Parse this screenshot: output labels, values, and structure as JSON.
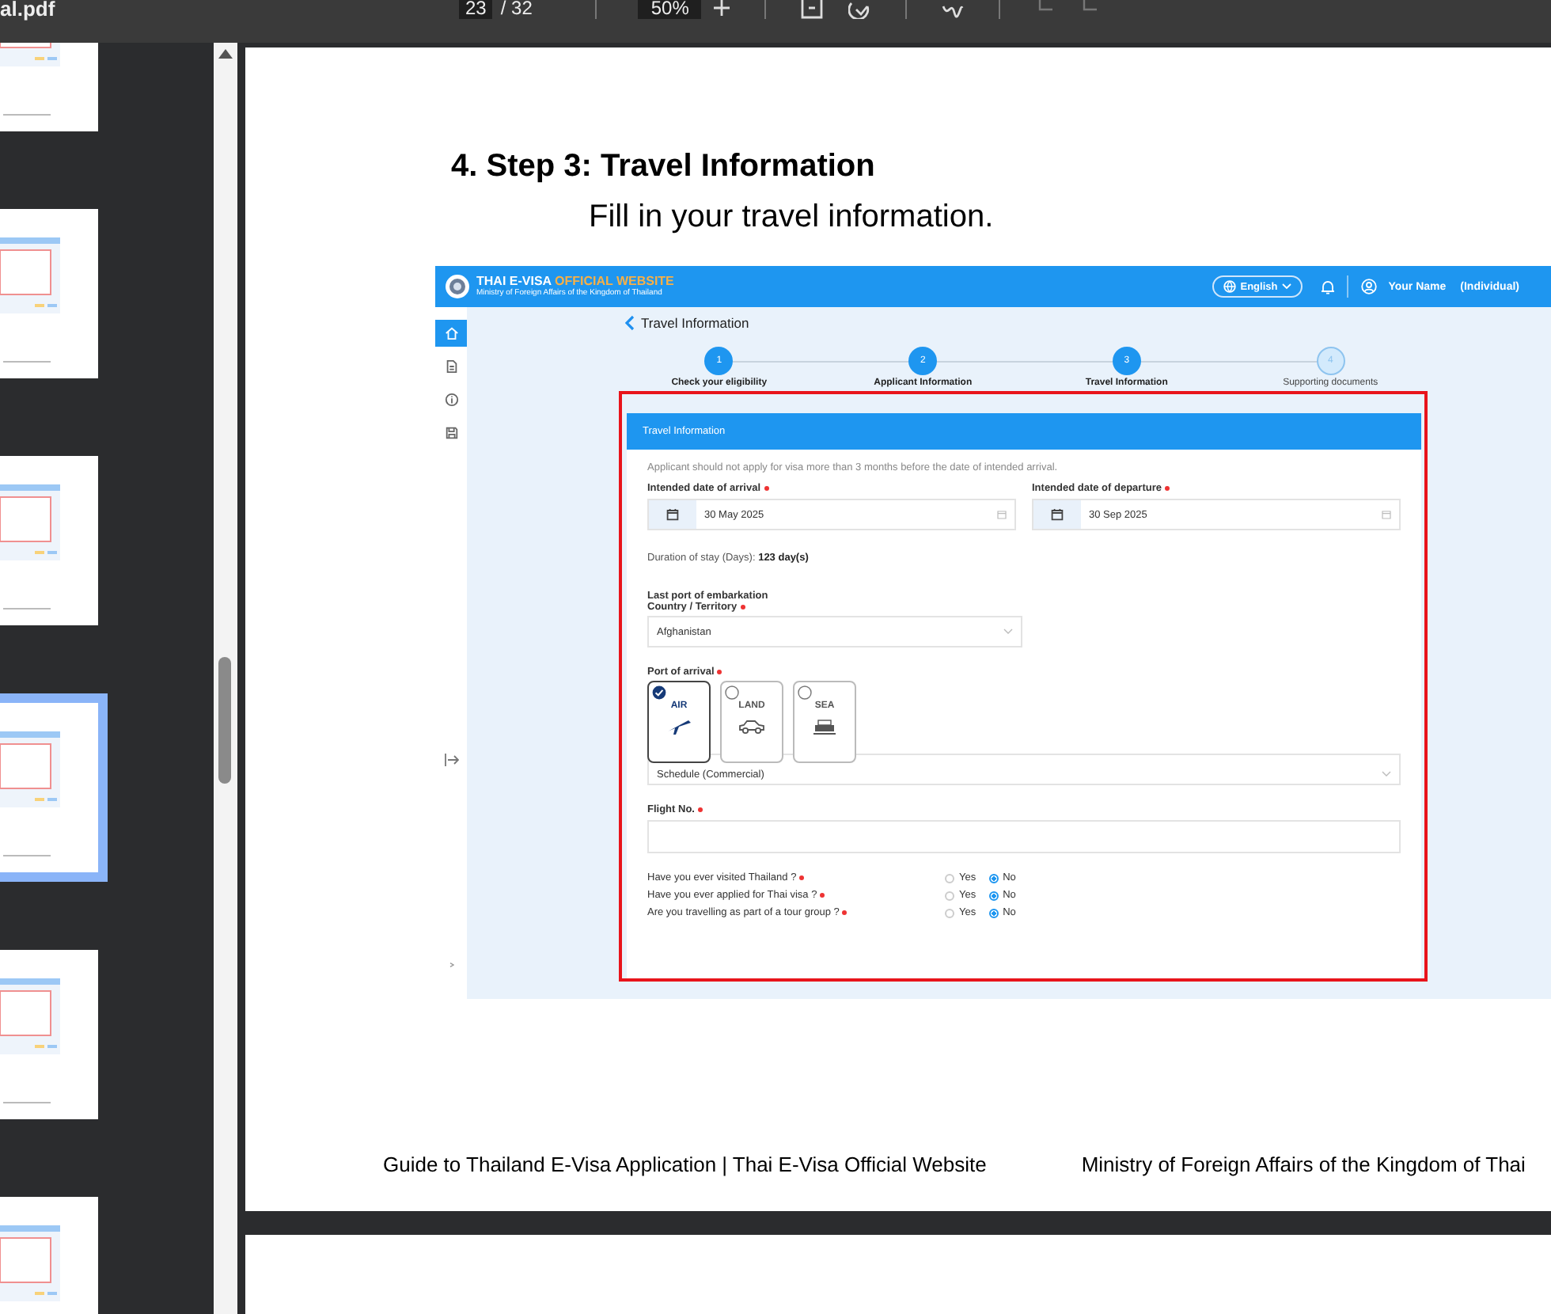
{
  "toolbar": {
    "file_name": "al.pdf",
    "page": "23",
    "page_total": "/ 32",
    "zoom": "50%"
  },
  "thumbnails": [
    {
      "selected": false
    },
    {
      "selected": false
    },
    {
      "selected": false
    },
    {
      "selected": true
    },
    {
      "selected": false
    },
    {
      "selected": false
    }
  ],
  "page": {
    "heading": "4. Step 3: Travel Information",
    "intro": "Fill in your travel information.",
    "footer_left": "Guide to Thailand E-Visa Application | Thai E-Visa Official Website",
    "footer_right": "Ministry of Foreign Affairs of the Kingdom of Thai"
  },
  "site": {
    "title": "THAI E-VISA",
    "title_highlight": "OFFICIAL WEBSITE",
    "subtitle": "Ministry of Foreign Affairs of the Kingdom of Thailand",
    "language": "English",
    "user": "Your Name",
    "role": "(Individual)",
    "nav": [
      {
        "kind": "home",
        "selected": true
      },
      {
        "kind": "document",
        "selected": false
      },
      {
        "kind": "info",
        "selected": false
      },
      {
        "kind": "save",
        "selected": false
      }
    ],
    "page_title": "Travel Information",
    "steps": [
      {
        "number": "1",
        "label": "Check your eligibility",
        "done": true
      },
      {
        "number": "2",
        "label": "Applicant Information",
        "done": true
      },
      {
        "number": "3",
        "label": "Travel Information",
        "done": true
      },
      {
        "number": "4",
        "label": "Supporting documents",
        "done": false
      }
    ]
  },
  "form": {
    "section_title": "Travel Information",
    "notice": "Applicant should not apply for visa more than 3 months before the date of intended arrival.",
    "dates": [
      {
        "label": "Intended date of arrival",
        "value": "30 May 2025",
        "required": true
      },
      {
        "label": "Intended date of departure",
        "value": "30 Sep 2025",
        "required": true
      }
    ],
    "duration_label": "Duration of stay (Days):",
    "duration_value": "123 day(s)",
    "embark_heading": "Last port of embarkation",
    "country_label": "Country / Territory",
    "country_required": true,
    "country_value": "Afghanistan",
    "port_label": "Port of arrival",
    "port_required": true,
    "ports": [
      {
        "label": "AIR",
        "kind": "air",
        "selected": true
      },
      {
        "label": "LAND",
        "kind": "land",
        "selected": false
      },
      {
        "label": "SEA",
        "kind": "sea",
        "selected": false
      }
    ],
    "schedule_value": "Schedule (Commercial)",
    "flight_label": "Flight No.",
    "flight_required": true,
    "questions": [
      {
        "text": "Have you ever visited Thailand ?",
        "required": true,
        "options": [
          {
            "label": "Yes",
            "selected": false
          },
          {
            "label": "No",
            "selected": true
          }
        ]
      },
      {
        "text": "Have you ever applied for Thai visa ?",
        "required": true,
        "options": [
          {
            "label": "Yes",
            "selected": false
          },
          {
            "label": "No",
            "selected": true
          }
        ]
      },
      {
        "text": "Are you travelling as part of a tour group ?",
        "required": true,
        "options": [
          {
            "label": "Yes",
            "selected": false
          },
          {
            "label": "No",
            "selected": true
          }
        ]
      }
    ]
  }
}
